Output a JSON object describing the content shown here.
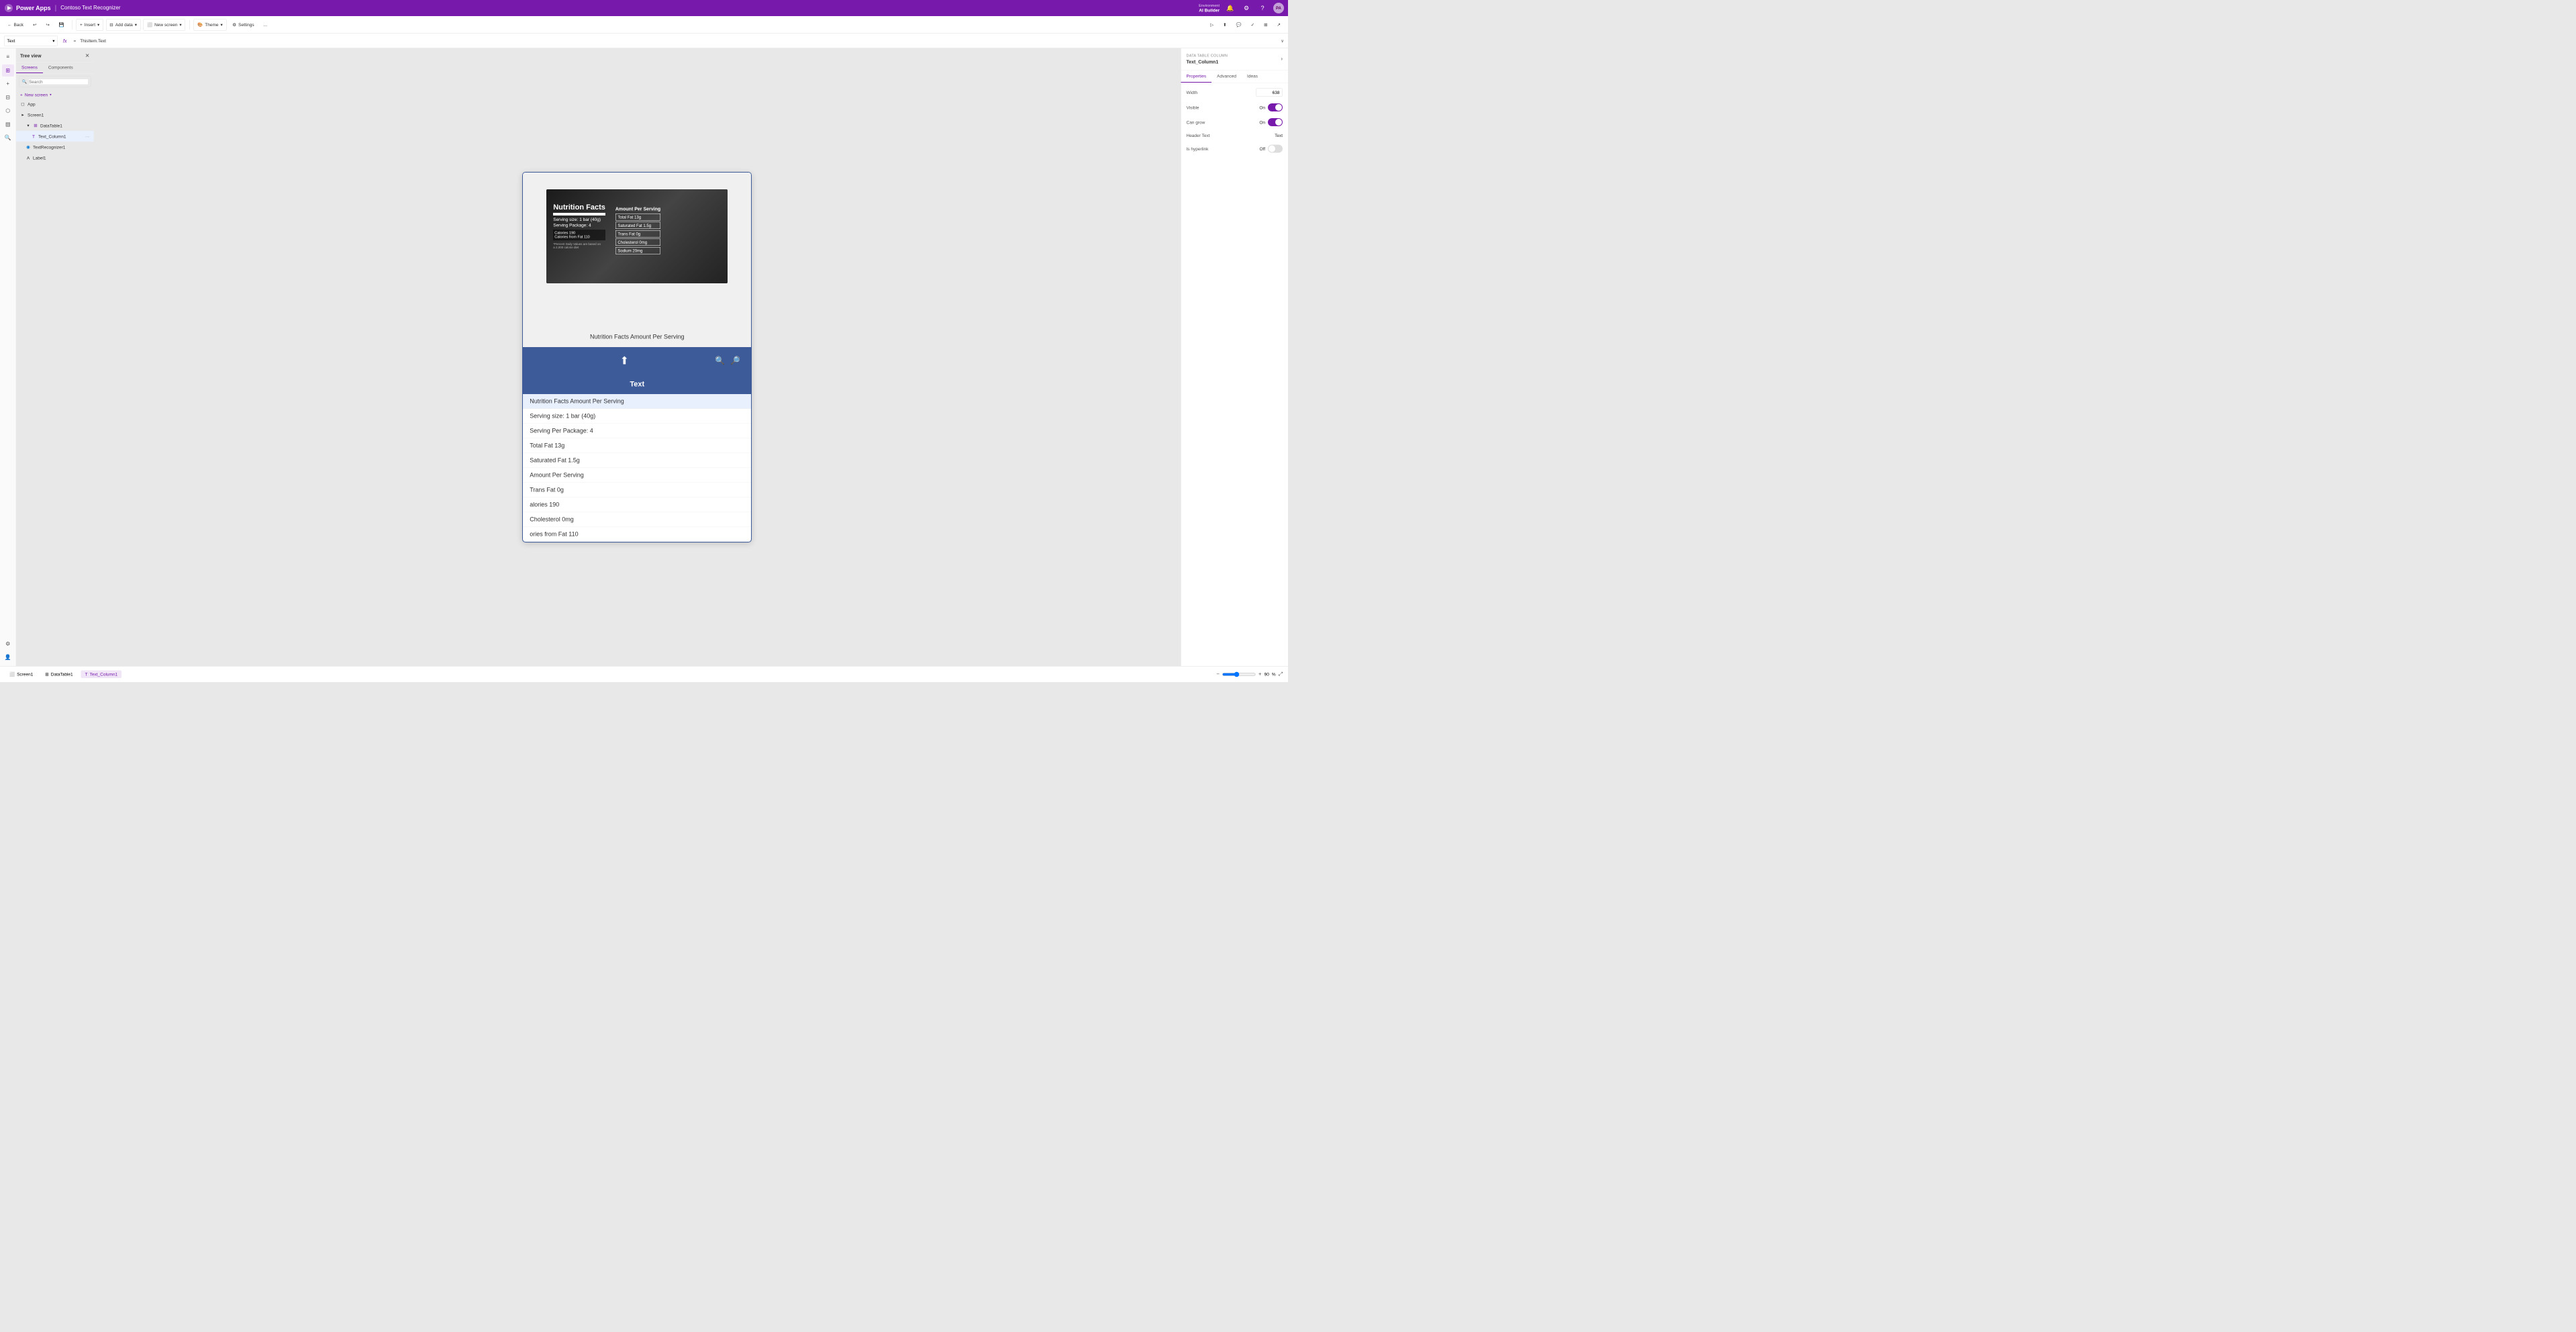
{
  "app": {
    "brand": "Power Apps",
    "separator": "|",
    "project_name": "Contoso Text Recognizer"
  },
  "title_bar": {
    "env_label": "Environment",
    "env_name": "AI Builder",
    "avatar_initials": "PA"
  },
  "toolbar": {
    "back_label": "Back",
    "undo_label": "↩",
    "redo_label": "↪",
    "insert_label": "Insert",
    "add_data_label": "Add data",
    "new_screen_label": "New screen",
    "theme_label": "Theme",
    "settings_label": "Settings",
    "more_label": "..."
  },
  "formula_bar": {
    "field_name": "Text",
    "fx_symbol": "fx",
    "equals_symbol": "=",
    "formula_text": "ThisItem.Text",
    "expand_icon": "∨"
  },
  "left_panel": {
    "title": "Tree view",
    "tabs": [
      {
        "label": "Screens",
        "active": true
      },
      {
        "label": "Components",
        "active": false
      }
    ],
    "search_placeholder": "Search",
    "new_screen_label": "New screen",
    "items": [
      {
        "id": "app",
        "label": "App",
        "icon": "◻",
        "indent": 0
      },
      {
        "id": "screen1",
        "label": "Screen1",
        "icon": "▸",
        "indent": 0
      },
      {
        "id": "datatable1",
        "label": "DataTable1",
        "icon": "▾",
        "indent": 1,
        "expanded": true
      },
      {
        "id": "textcolumn1",
        "label": "Text_Column1",
        "icon": "T",
        "indent": 2,
        "selected": true
      },
      {
        "id": "textrecognizer1",
        "label": "TextRecognizer1",
        "icon": "◉",
        "indent": 1
      },
      {
        "id": "label1",
        "label": "Label1",
        "icon": "A",
        "indent": 1
      }
    ]
  },
  "canvas": {
    "phone_content": {
      "column_header": "Text",
      "table_rows": [
        {
          "text": "Nutrition Facts Amount Per Serving",
          "selected": true
        },
        {
          "text": "Serving size: 1 bar (40g)"
        },
        {
          "text": "Serving Per Package: 4"
        },
        {
          "text": "Total Fat 13g"
        },
        {
          "text": "Saturated Fat 1.5g"
        },
        {
          "text": "Amount Per Serving"
        },
        {
          "text": "Trans Fat 0g"
        },
        {
          "text": "alories 190"
        },
        {
          "text": "Cholesterol 0mg"
        },
        {
          "text": "ories from Fat 110"
        }
      ],
      "above_table_text": "Nutrition Facts Amount Per Serving"
    }
  },
  "right_panel": {
    "nav_label": "DATA TABLE COLUMN",
    "column_name": "Text_Column1",
    "tabs": [
      {
        "label": "Properties",
        "active": true
      },
      {
        "label": "Advanced",
        "active": false
      },
      {
        "label": "Ideas",
        "active": false
      }
    ],
    "properties": [
      {
        "label": "Width",
        "type": "input",
        "value": "638"
      },
      {
        "label": "Visible",
        "type": "toggle",
        "on_label": "On",
        "value": true
      },
      {
        "label": "Can grow",
        "type": "toggle",
        "on_label": "On",
        "value": true
      },
      {
        "label": "Header Text",
        "type": "text",
        "value": "Text"
      },
      {
        "label": "Is hyperlink",
        "type": "toggle-off",
        "off_label": "Off",
        "value": false
      }
    ]
  },
  "status_bar": {
    "tabs": [
      {
        "label": "Screen1",
        "icon": "⬜",
        "active": false
      },
      {
        "label": "DataTable1",
        "icon": "⊞",
        "active": false
      },
      {
        "label": "Text_Column1",
        "icon": "T",
        "active": true
      }
    ],
    "zoom_minus": "−",
    "zoom_value": "90",
    "zoom_unit": "%",
    "zoom_plus": "+",
    "fit_icon": "⤢"
  },
  "icons": {
    "search": "🔍",
    "close": "✕",
    "chevron_down": "▾",
    "chevron_right": "▸",
    "add": "+",
    "undo": "↩",
    "redo": "↪",
    "back_arrow": "←",
    "upload": "⬆",
    "zoom_in": "🔍+",
    "zoom_out": "🔍-",
    "menu": "≡",
    "tree": "⊞",
    "components": "◎",
    "data": "⊟",
    "settings": "⚙",
    "arrow_right": "›",
    "table_icon": "⊞",
    "text_icon": "T",
    "label_icon": "A"
  }
}
